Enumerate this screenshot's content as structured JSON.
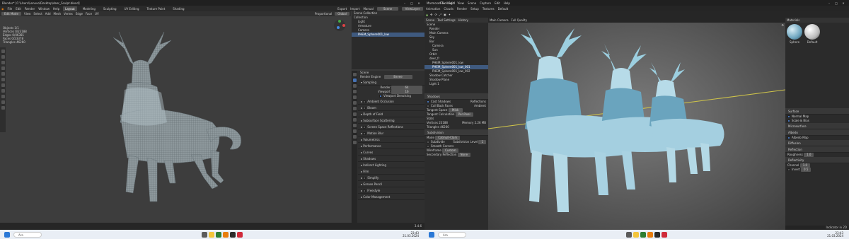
{
  "left": {
    "title": "Blender* [C:\\Users\\Lenovo\\Desktop\\deer_Sculpt.blend]",
    "menus": [
      "File",
      "Edit",
      "Render",
      "Window",
      "Help"
    ],
    "tabs": [
      "Layout",
      "Modeling",
      "Sculpting",
      "UV Editing",
      "Texture Paint",
      "Shading",
      "Animation",
      "Rendering",
      "Compositing",
      "Geometry Nodes",
      "Scripting"
    ],
    "active_tab": "Layout",
    "top_right": {
      "export": "Export",
      "import": "Import",
      "manual": "Manual",
      "scene": "Scene",
      "view_layer": "ViewLayer"
    },
    "header": {
      "mode": "Edit Mode",
      "items": [
        "View",
        "Select",
        "Add",
        "Mesh",
        "Vertex",
        "Edge",
        "Face",
        "UV"
      ],
      "transform": "Global",
      "pivot": "Proportional"
    },
    "stats": [
      "Objects   1/1",
      "Vertices   0/23188",
      "Edges   0/46381",
      "Faces   0/23378",
      "Triangles   46260"
    ],
    "outliner": {
      "header": "Scene Collection",
      "rows": [
        "Collection",
        "Light",
        "Armature",
        "Camera",
        "PHEM_Sphere001_low"
      ],
      "selected": 4
    },
    "properties": {
      "scene": "Scene",
      "render_engine_label": "Render Engine",
      "render_engine": "Eevee",
      "sampling": "Sampling",
      "render_label": "Render",
      "render_value": "64",
      "viewport_label": "Viewport",
      "viewport_value": "16",
      "viewport_denoise": "Viewport Denoising",
      "sections": [
        "Ambient Occlusion",
        "Bloom",
        "Depth of Field",
        "Subsurface Scattering",
        "Screen Space Reflections",
        "Motion Blur",
        "Volumetrics",
        "Performance",
        "Curves",
        "Shadows",
        "Indirect Lighting",
        "Film",
        "Simplify",
        "Grease Pencil",
        "Freestyle",
        "Color Management"
      ]
    },
    "status": "3.4.6",
    "taskbar": {
      "search": "Ara",
      "time": "23:43",
      "date": "21.03.2024"
    }
  },
  "right": {
    "title": "Marmoset Toolbag 4",
    "menus": [
      "File",
      "Edit",
      "View",
      "Scene",
      "Capture",
      "Edit",
      "Help"
    ],
    "tabs": [
      "Animation",
      "Clouds",
      "Render",
      "Setup",
      "Textures",
      "Default"
    ],
    "scene_panel_tabs": [
      "Scene",
      "Tool Settings",
      "History"
    ],
    "scene_tree": [
      "Scene",
      "Render",
      "Main Camera",
      "Sky",
      "Bur",
      "Camera",
      "Sun",
      "Orbit",
      "deer_fr",
      "PHEM_Sphere001_low",
      "PHEM_Sphere001_low_001",
      "PHEM_Sphere001_low_002",
      "Shadow Catcher",
      "Shadow Plane",
      "Light 1"
    ],
    "scene_selected": 10,
    "viewport_tabs": [
      "Main Camera",
      "Full Quality"
    ],
    "render_panel": {
      "shadows": "Shadows",
      "rows": [
        "Cast Shadows",
        "Cull Back Faces"
      ],
      "extra": [
        "Reflections",
        "Ambient"
      ],
      "tangent_space_label": "Tangent Space",
      "tangent_space": "Mikk",
      "tangent_calc_label": "Tangent Calculation",
      "tangent_calc": "Per-Pixel",
      "stats_label": "Stats",
      "verts_label": "Vertices",
      "verts": "23188",
      "mem_label": "Memory",
      "mem": "2.26 MB",
      "tris_label": "Triangles",
      "tris": "46260",
      "subdivision": "Subdivision",
      "mode_label": "Mode",
      "mode": "Catmull-Clark",
      "subdivide": "Subdivide",
      "smooth": "Smooth Corners",
      "level_label": "Subdivision Level",
      "level": "1",
      "wireframe_label": "Wireframe",
      "wireframe": "Custom",
      "recursion_label": "Secondary Reflection",
      "recursion": "None"
    },
    "material_panel": {
      "header": "Materials",
      "materials": [
        "Sphere",
        "Default"
      ],
      "sections": [
        "Surface",
        "Microsurface",
        "Albedo",
        "Diffusion",
        "Reflection",
        "Reflectivity"
      ],
      "rows": [
        "Normal Map",
        "Scale & Bias",
        "Albedo Map",
        "Roughness",
        "Channel",
        "Invert"
      ],
      "values": [
        "1.0",
        "1.0",
        "0.5"
      ]
    },
    "status": "Indicator in 2D",
    "taskbar": {
      "search": "Ara",
      "time": "23:43",
      "date": "21.03.2024"
    }
  },
  "colors": {
    "accent": "#4772b3",
    "deer": "#8fbcd4",
    "deer_dark": "#4f7f99",
    "sculpt": "#9aa3a7",
    "axis": "#cfc44a"
  }
}
